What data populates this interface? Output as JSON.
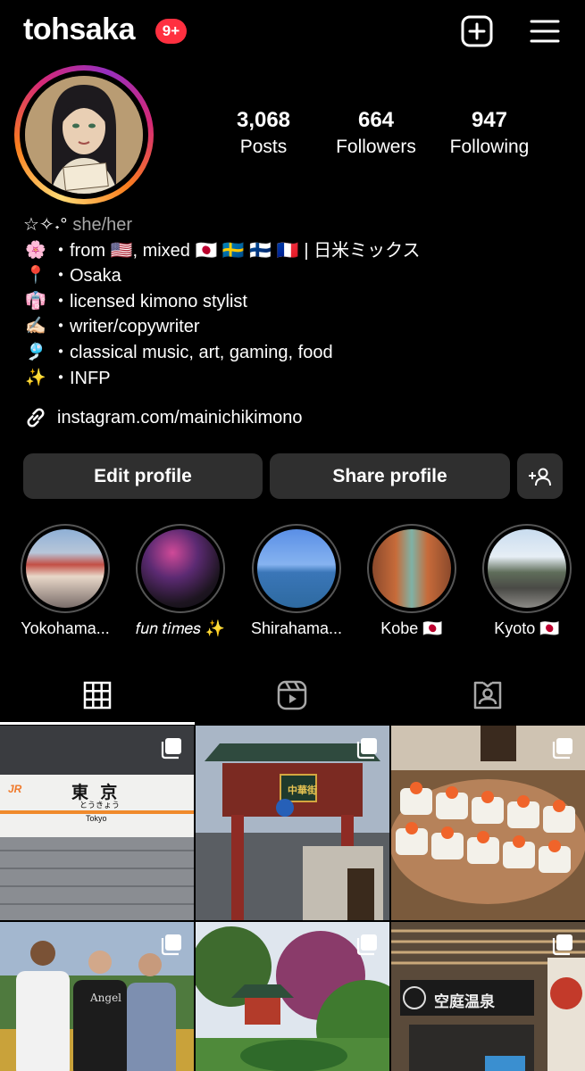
{
  "header": {
    "username": "tohsaka",
    "notification_badge": "9+",
    "icons": [
      "new-post-icon",
      "menu-icon"
    ]
  },
  "profile": {
    "stats": [
      {
        "value": "3,068",
        "label": "Posts"
      },
      {
        "value": "664",
        "label": "Followers"
      },
      {
        "value": "947",
        "label": "Following"
      }
    ],
    "pronoun_prefix": "☆✧˖°",
    "pronouns": "she/her",
    "bio": [
      {
        "emoji": "🌸",
        "text": "・from 🇺🇸, mixed 🇯🇵 🇸🇪 🇫🇮 🇫🇷 | 日米ミックス"
      },
      {
        "emoji": "📍",
        "text": "・Osaka"
      },
      {
        "emoji": "👘",
        "text": "・licensed kimono stylist"
      },
      {
        "emoji": "✍🏻",
        "text": "・writer/copywriter"
      },
      {
        "emoji": "🎐",
        "text": "・classical music, art, gaming, food"
      },
      {
        "emoji": "✨",
        "text": "・INFP"
      }
    ],
    "link": "instagram.com/mainichikimono"
  },
  "actions": {
    "edit_label": "Edit profile",
    "share_label": "Share profile",
    "discover_icon": "add-person-icon"
  },
  "highlights": [
    {
      "label": "Yokohama..."
    },
    {
      "label": "𝑓𝑢𝑛 𝑡𝑖𝑚𝑒𝑠 ✨"
    },
    {
      "label": "Shirahama..."
    },
    {
      "label": "Kobe 🇯🇵"
    },
    {
      "label": "Kyoto 🇯🇵"
    }
  ],
  "tabs": [
    "grid-icon",
    "reels-icon",
    "tagged-icon"
  ],
  "posts": [
    {
      "type": "carousel",
      "sign_text": "東 京",
      "sign_kana": "とうきょう",
      "sign_roman": "Tokyo",
      "logo": "JR"
    },
    {
      "type": "carousel",
      "sign_text": "中華街"
    },
    {
      "type": "carousel"
    },
    {
      "type": "carousel",
      "shirt_text": "Angel"
    },
    {
      "type": "carousel"
    },
    {
      "type": "carousel",
      "sign_text": "空庭温泉"
    }
  ],
  "colors": {
    "background": "#000000",
    "button_bg": "#2f2f2f",
    "badge": "#ff3040",
    "secondary_text": "#a8a8a8"
  }
}
